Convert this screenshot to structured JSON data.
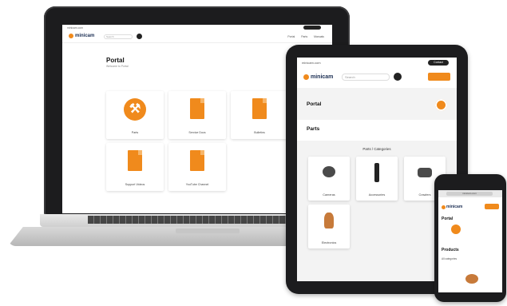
{
  "brand": {
    "logo_text": "minicam",
    "accent_color": "#f08a1c",
    "dark_color": "#1b2e53"
  },
  "laptop": {
    "topbar_text": "minicam.com",
    "search_placeholder": "Search",
    "nav_links": [
      "Portal",
      "Parts",
      "Manuals"
    ],
    "page_title": "Portal",
    "page_subtitle": "Welcome to Portal",
    "tiles": [
      {
        "label": "Parts",
        "icon": "wrench-icon"
      },
      {
        "label": "Service Docs",
        "icon": "document-camera-icon"
      },
      {
        "label": "Bulletins",
        "icon": "document-icon"
      },
      {
        "label": "Support Videos",
        "icon": "video-play-icon"
      },
      {
        "label": "YouTube Channel",
        "icon": "youtube-icon"
      }
    ]
  },
  "tablet": {
    "topbar_text": "minicam.com",
    "topbar_button": "Contact",
    "search_placeholder": "Search",
    "page_title": "Portal",
    "section_title": "Parts",
    "category_heading": "Parts / Categories",
    "categories": [
      {
        "label": "Cameras",
        "icon": "camera-product-icon"
      },
      {
        "label": "Accessories",
        "icon": "push-rod-icon"
      },
      {
        "label": "Crawlers",
        "icon": "crawler-icon"
      },
      {
        "label": "Electronics",
        "icon": "electronics-icon"
      }
    ]
  },
  "phone": {
    "url_text": "minicam.com",
    "page_title": "Portal",
    "section_title": "Products",
    "section_sub": "All categories"
  }
}
